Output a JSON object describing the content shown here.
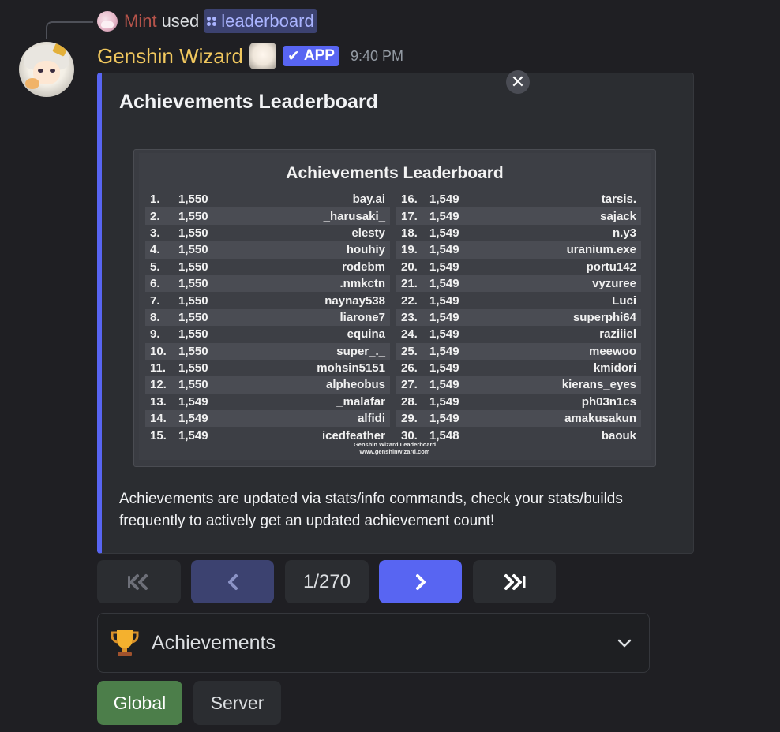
{
  "reply": {
    "user": "Mint",
    "used": "used",
    "command": "leaderboard"
  },
  "header": {
    "bot_name": "Genshin Wizard",
    "app_tag": "APP",
    "timestamp": "9:40 PM"
  },
  "embed": {
    "title": "Achievements Leaderboard",
    "description": "Achievements are updated via stats/info commands, check your stats/builds frequently to actively get an updated achievement count!",
    "accent_color": "#5865f2",
    "image": {
      "title": "Achievements Leaderboard",
      "footer_line1": "Genshin Wizard Leaderboard",
      "footer_line2": "www.genshinwizard.com",
      "left_column": [
        {
          "rank": "1.",
          "score": "1,550",
          "name": "bay.ai"
        },
        {
          "rank": "2.",
          "score": "1,550",
          "name": "_harusaki_"
        },
        {
          "rank": "3.",
          "score": "1,550",
          "name": "elesty"
        },
        {
          "rank": "4.",
          "score": "1,550",
          "name": "houhiy"
        },
        {
          "rank": "5.",
          "score": "1,550",
          "name": "rodebm"
        },
        {
          "rank": "6.",
          "score": "1,550",
          "name": ".nmkctn"
        },
        {
          "rank": "7.",
          "score": "1,550",
          "name": "naynay538"
        },
        {
          "rank": "8.",
          "score": "1,550",
          "name": "liarone7"
        },
        {
          "rank": "9.",
          "score": "1,550",
          "name": "equina"
        },
        {
          "rank": "10.",
          "score": "1,550",
          "name": "super_._"
        },
        {
          "rank": "11.",
          "score": "1,550",
          "name": "mohsin5151"
        },
        {
          "rank": "12.",
          "score": "1,550",
          "name": "alpheobus"
        },
        {
          "rank": "13.",
          "score": "1,549",
          "name": "_malafar"
        },
        {
          "rank": "14.",
          "score": "1,549",
          "name": "alfidi"
        },
        {
          "rank": "15.",
          "score": "1,549",
          "name": "icedfeather"
        }
      ],
      "right_column": [
        {
          "rank": "16.",
          "score": "1,549",
          "name": "tarsis."
        },
        {
          "rank": "17.",
          "score": "1,549",
          "name": "sajack"
        },
        {
          "rank": "18.",
          "score": "1,549",
          "name": "n.y3"
        },
        {
          "rank": "19.",
          "score": "1,549",
          "name": "uranium.exe"
        },
        {
          "rank": "20.",
          "score": "1,549",
          "name": "portu142"
        },
        {
          "rank": "21.",
          "score": "1,549",
          "name": "vyzuree"
        },
        {
          "rank": "22.",
          "score": "1,549",
          "name": "Luci"
        },
        {
          "rank": "23.",
          "score": "1,549",
          "name": "superphi64"
        },
        {
          "rank": "24.",
          "score": "1,549",
          "name": "raziiiel"
        },
        {
          "rank": "25.",
          "score": "1,549",
          "name": "meewoo"
        },
        {
          "rank": "26.",
          "score": "1,549",
          "name": "kmidori"
        },
        {
          "rank": "27.",
          "score": "1,549",
          "name": "kierans_eyes"
        },
        {
          "rank": "28.",
          "score": "1,549",
          "name": "ph03n1cs"
        },
        {
          "rank": "29.",
          "score": "1,549",
          "name": "amakusakun"
        },
        {
          "rank": "30.",
          "score": "1,548",
          "name": "baouk"
        }
      ]
    }
  },
  "pager": {
    "first_icon": "double-chevron-left-icon",
    "prev_icon": "chevron-left-icon",
    "page_label": "1/270",
    "next_icon": "chevron-right-icon",
    "last_icon": "skip-to-end-icon"
  },
  "select": {
    "icon": "trophy-icon",
    "selected": "Achievements"
  },
  "buttons": {
    "global": "Global",
    "server": "Server"
  }
}
